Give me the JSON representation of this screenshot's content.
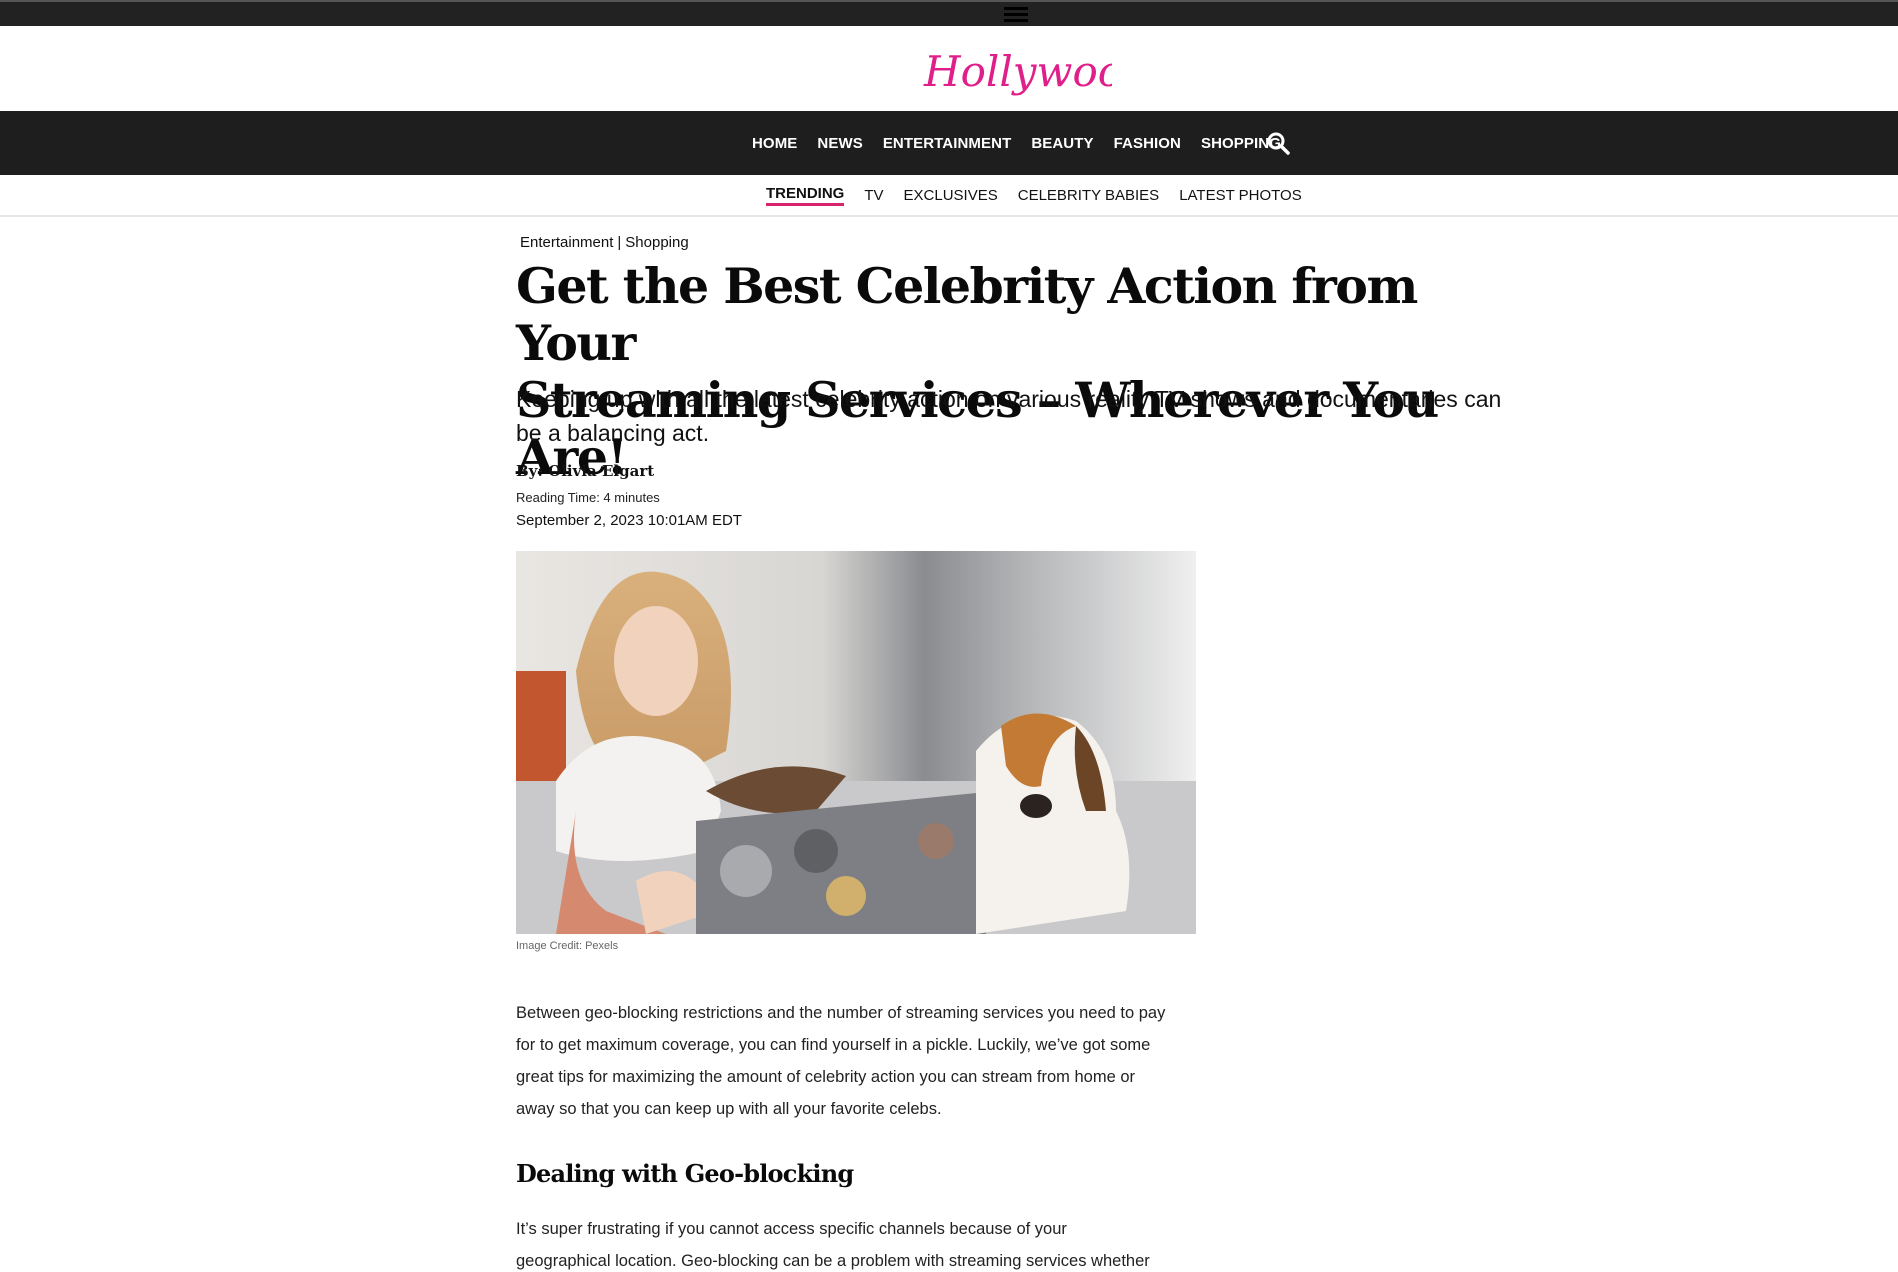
{
  "logo": {
    "text": "Hollywood Life",
    "color": "#e0208a"
  },
  "main_nav": {
    "items": [
      "HOME",
      "NEWS",
      "ENTERTAINMENT",
      "BEAUTY",
      "FASHION",
      "SHOPPING"
    ],
    "search_icon": "search-icon"
  },
  "sub_nav": {
    "items": [
      "TRENDING",
      "TV",
      "EXCLUSIVES",
      "CELEBRITY BABIES",
      "LATEST PHOTOS"
    ],
    "active": "TRENDING",
    "accent": "#d8236d"
  },
  "article": {
    "categories": [
      "Entertainment",
      "Shopping"
    ],
    "category_separator": "|",
    "headline_line1": "Get the Best Celebrity Action from Your",
    "headline_line2": "Streaming Services – Wherever You Are!",
    "dek": "Keeping up with all the latest celebrity action on various reality TV shows and documentaries can be a balancing act.",
    "byline_prefix": "By: ",
    "author": "Olivia Elgart",
    "reading_time": "Reading Time: 4 minutes",
    "date": "September 2, 2023 10:01AM  EDT",
    "image_credit": "Image Credit: Pexels",
    "paragraph1_line1": "Between geo-blocking restrictions and the number of streaming services you need to pay",
    "paragraph1_line2": "for to get maximum coverage, you can find yourself in a pickle.  Luckily, we’ve got some",
    "paragraph1_line3": "great tips for maximizing the amount of celebrity action you can stream from home or",
    "paragraph1_line4": "away so that you can keep up with all your favorite celebs.",
    "subheading": "Dealing with Geo-blocking",
    "paragraph2_line1": "It’s super frustrating if you cannot access specific channels because of your",
    "paragraph2_line2": "geographical location. Geo-blocking can be a problem with streaming services whether"
  }
}
